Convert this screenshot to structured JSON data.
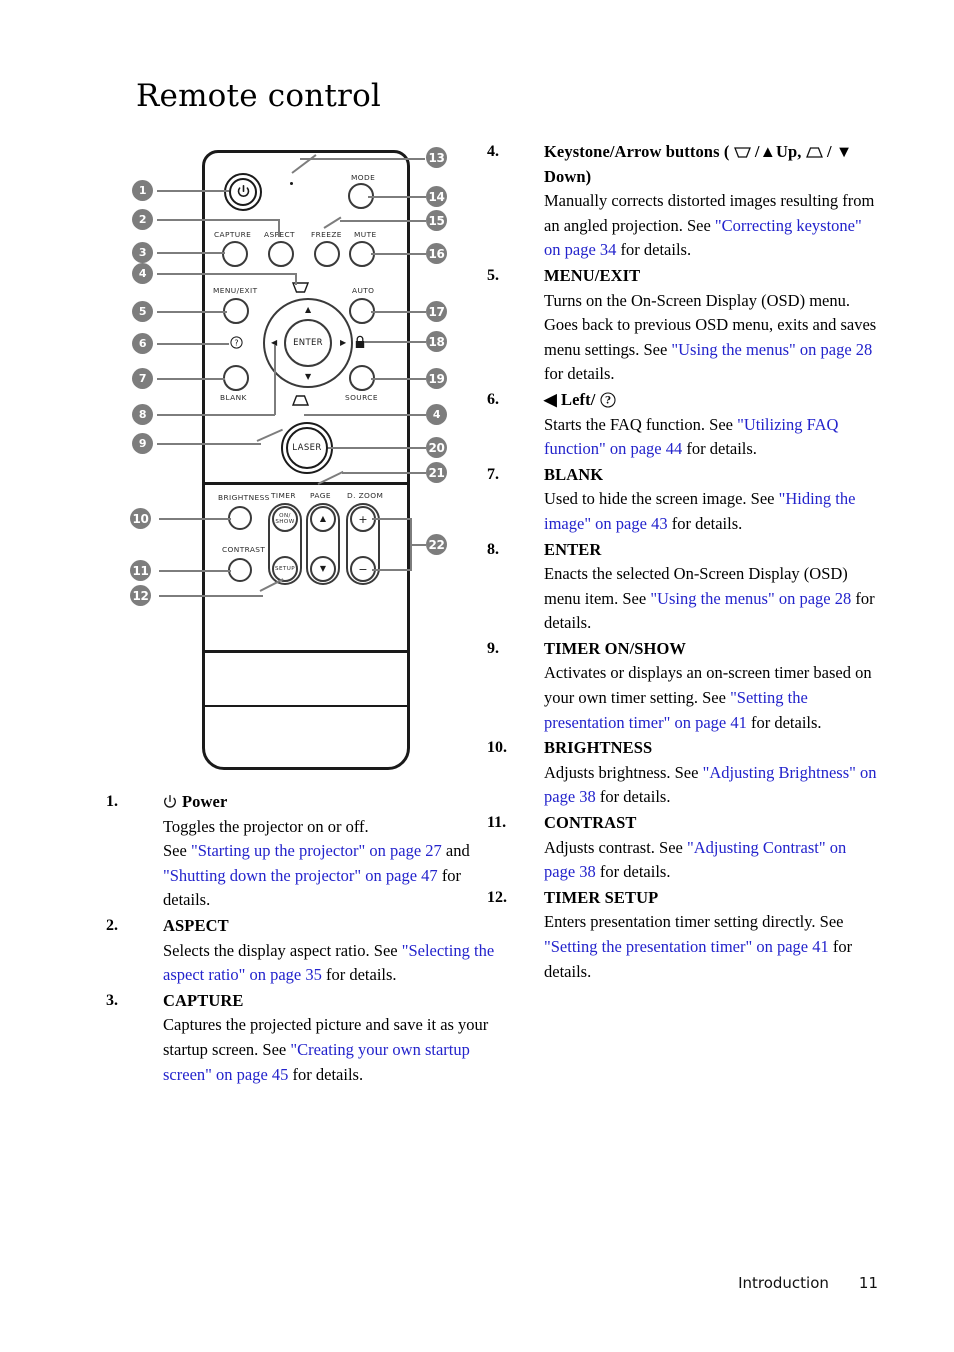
{
  "page": {
    "title": "Remote control",
    "footer_section": "Introduction",
    "footer_page": "11"
  },
  "colors": {
    "link": "#2323cc",
    "callout_fill": "#7d7d7d",
    "outline": "#1a1a1a"
  },
  "figure": {
    "name": "remote-control-diagram",
    "button_labels": {
      "capture": "CAPTURE",
      "aspect": "ASPECT",
      "freeze": "FREEZE",
      "mute": "MUTE",
      "mode": "MODE",
      "menu_exit": "MENU/EXIT",
      "auto": "AUTO",
      "blank": "BLANK",
      "source": "SOURCE",
      "enter": "ENTER",
      "laser": "LASER",
      "brightness": "BRIGHTNESS",
      "contrast": "CONTRAST",
      "timer": "TIMER",
      "timer_on_show_1": "ON/",
      "timer_on_show_2": "SHOW",
      "timer_setup": "SETUP",
      "page": "PAGE",
      "d_zoom": "D. ZOOM",
      "plus": "+",
      "minus": "−"
    },
    "callouts_left": [
      "1",
      "2",
      "3",
      "4",
      "5",
      "6",
      "7",
      "8",
      "9",
      "10",
      "11",
      "12"
    ],
    "callouts_right": [
      "13",
      "14",
      "15",
      "16",
      "17",
      "18",
      "19",
      "4",
      "20",
      "21",
      "22"
    ]
  },
  "left_column": [
    {
      "num": "1.",
      "heading_icon": "power-icon",
      "heading": "Power",
      "lines": [
        {
          "t": "Toggles the projector on or off."
        },
        {
          "t": "See "
        },
        {
          "t": "\"Starting up the projector\" on page 27",
          "link": true
        },
        {
          "t": " and "
        },
        {
          "t": "\"Shutting down the projector\" on page 47",
          "link": true
        },
        {
          "t": " for details."
        }
      ]
    },
    {
      "num": "2.",
      "heading": "ASPECT",
      "lines": [
        {
          "t": "Selects the display aspect ratio. See "
        },
        {
          "t": "\"Selecting the aspect ratio\" on page 35",
          "link": true
        },
        {
          "t": " for details."
        }
      ]
    },
    {
      "num": "3.",
      "heading": "CAPTURE",
      "lines": [
        {
          "t": "Captures the projected picture and save it as your startup screen. See "
        },
        {
          "t": "\"Creating your own startup screen\" on page 45",
          "link": true
        },
        {
          "t": " for details."
        }
      ]
    }
  ],
  "right_column": [
    {
      "num": "4.",
      "heading_pre": "Keystone/Arrow buttons ( ",
      "heading_mid": " /▲Up, ",
      "heading_post": " / ▼ Down)",
      "lines": [
        {
          "t": "Manually corrects distorted images resulting from an angled projection. See "
        },
        {
          "t": "\"Correcting keystone\" on page 34",
          "link": true
        },
        {
          "t": " for details."
        }
      ]
    },
    {
      "num": "5.",
      "heading": "MENU/EXIT",
      "lines": [
        {
          "t": "Turns on the On-Screen Display (OSD) menu. Goes back to previous OSD menu, exits and saves menu settings. See "
        },
        {
          "t": "\"Using the menus\" on page 28",
          "link": true
        },
        {
          "t": " for details."
        }
      ]
    },
    {
      "num": "6.",
      "heading": "◀ Left/",
      "heading_icon": "question-mark-icon",
      "lines": [
        {
          "t": "Starts the FAQ function. See "
        },
        {
          "t": "\"Utilizing FAQ function\" on page 44",
          "link": true
        },
        {
          "t": " for details."
        }
      ]
    },
    {
      "num": "7.",
      "heading": "BLANK",
      "lines": [
        {
          "t": "Used to hide the screen image. See "
        },
        {
          "t": "\"Hiding the image\" on page 43",
          "link": true
        },
        {
          "t": " for details."
        }
      ]
    },
    {
      "num": "8.",
      "heading": "ENTER",
      "lines": [
        {
          "t": "Enacts the selected On-Screen Display (OSD) menu item. See "
        },
        {
          "t": "\"Using the menus\" on page 28",
          "link": true
        },
        {
          "t": " for details."
        }
      ]
    },
    {
      "num": "9.",
      "heading": "TIMER ON/SHOW",
      "lines": [
        {
          "t": "Activates or displays an on-screen timer based on your own timer setting. See "
        },
        {
          "t": "\"Setting the presentation timer\" on page 41",
          "link": true
        },
        {
          "t": " for details."
        }
      ]
    },
    {
      "num": "10.",
      "heading": "BRIGHTNESS",
      "lines": [
        {
          "t": "Adjusts brightness. See "
        },
        {
          "t": "\"Adjusting Brightness\" on page 38",
          "link": true
        },
        {
          "t": " for details."
        }
      ]
    },
    {
      "num": "11.",
      "heading": "CONTRAST",
      "lines": [
        {
          "t": "Adjusts contrast. See "
        },
        {
          "t": "\"Adjusting Contrast\" on page 38",
          "link": true
        },
        {
          "t": " for details."
        }
      ]
    },
    {
      "num": "12.",
      "heading": "TIMER SETUP",
      "lines": [
        {
          "t": "Enters presentation timer setting directly. See "
        },
        {
          "t": "\"Setting the presentation timer\" on page 41",
          "link": true
        },
        {
          "t": " for details."
        }
      ]
    }
  ]
}
